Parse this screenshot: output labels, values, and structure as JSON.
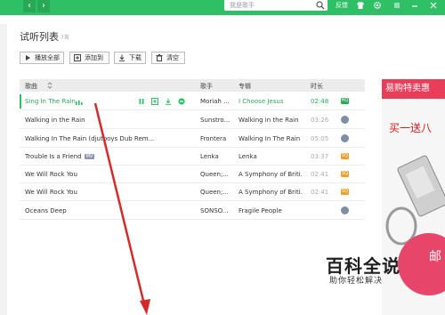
{
  "topbar": {
    "search_placeholder": "我是歌手",
    "feedback_label": "反馈"
  },
  "page": {
    "title": "试听列表",
    "count": "7首"
  },
  "toolbar": {
    "play_all": "播放全部",
    "add_to": "添加到",
    "download": "下载",
    "clear": "清空"
  },
  "table": {
    "headers": {
      "song": "歌曲",
      "artist": "歌手",
      "album": "专辑",
      "duration": "时长"
    },
    "rows": [
      {
        "song": "Sing In The Rain",
        "artist": "Moriah ...",
        "album": "I Choose Jesus",
        "duration": "02:48",
        "quality": "HQ"
      },
      {
        "song": "Walking in the Rain",
        "artist": "Sunstro...",
        "album": "Walking in the Rain",
        "duration": "03:26",
        "quality": "globe"
      },
      {
        "song": "Walking In The Rain (djutboys Dub Rem...",
        "artist": "Frontera",
        "album": "Walking In The Rain",
        "duration": "05:05",
        "quality": "globe"
      },
      {
        "song": "Trouble Is a Friend",
        "mv": "MV",
        "artist": "Lenka",
        "album": "Lenka",
        "duration": "03:37",
        "quality": "SQ"
      },
      {
        "song": "We Will Rock You",
        "artist": "Queen;...",
        "album": "A Symphony of Briti...",
        "duration": "02:41",
        "quality": "SQ"
      },
      {
        "song": "We Will Rock You",
        "artist": "Queen;...",
        "album": "A Symphony of Briti...",
        "duration": "02:41",
        "quality": "SQ"
      },
      {
        "song": "Oceans Deep",
        "artist": "SONSO...",
        "album": "Fragile People",
        "duration": "",
        "quality": "globe"
      }
    ]
  },
  "ad": {
    "banner": "易购特卖惠",
    "headline": "买一送八",
    "badge": "邮"
  },
  "watermark": {
    "brand": "百科全说",
    "sub": "助你轻松解决"
  },
  "colors": {
    "accent": "#2fbf64",
    "hq": "#2fa65a",
    "sq": "#f0a02a",
    "arrow": "#d62a2a"
  }
}
